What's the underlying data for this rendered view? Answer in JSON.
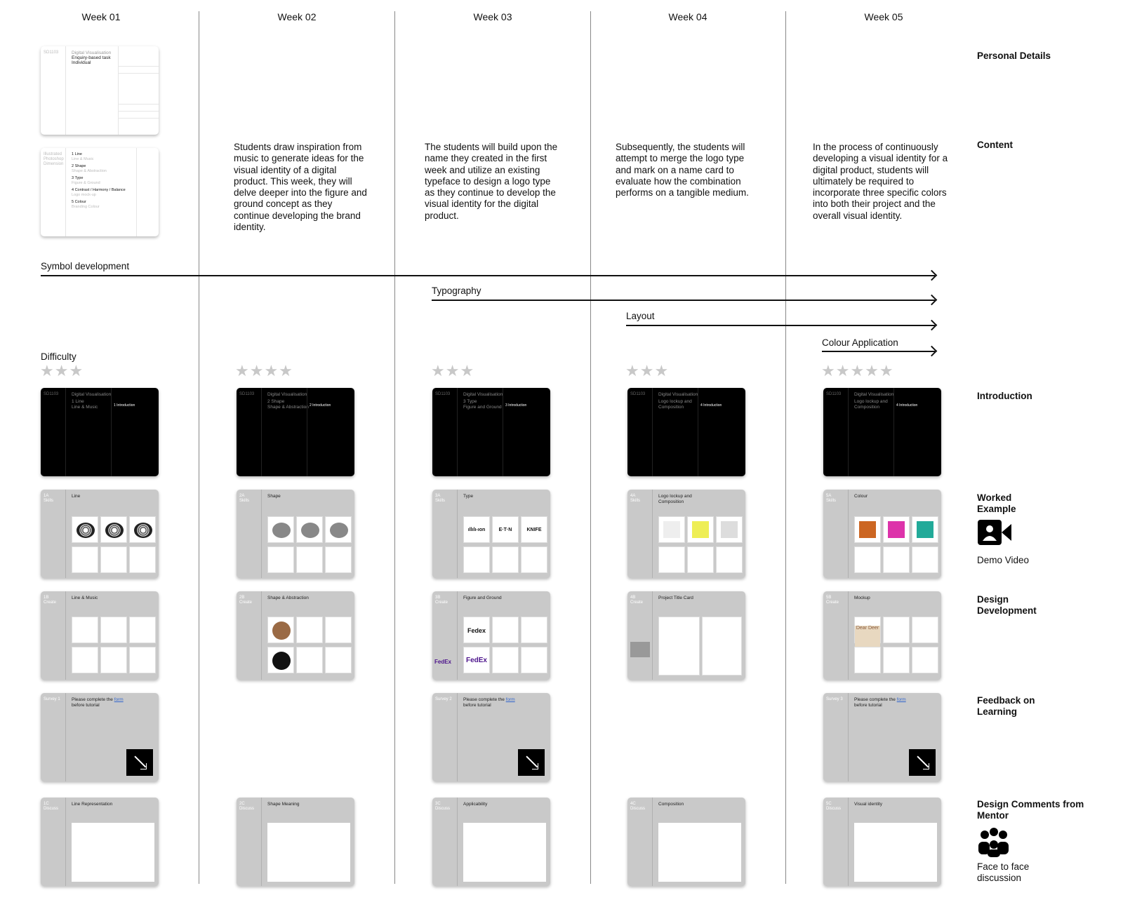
{
  "weeks": [
    "Week 01",
    "Week 02",
    "Week 03",
    "Week 04",
    "Week 05"
  ],
  "row_labels": {
    "personal_details": "Personal Details",
    "content": "Content",
    "introduction": "Introduction",
    "worked_example": "Worked Example",
    "demo_video": "Demo Video",
    "design_development": "Design Development",
    "feedback": "Feedback on Learning",
    "mentor": "Design Comments from Mentor",
    "face_to_face": "Face to face discussion"
  },
  "content_paragraphs": {
    "week02": "Students draw inspiration from music to generate ideas for the visual identity of a digital product. This week, they will delve deeper into the figure and ground concept as they continue developing the brand identity.",
    "week03": "The students will build upon the name they created in the first week and utilize an existing typeface to design a logo type as they continue to develop the visual identity for the digital product.",
    "week04": "Subsequently, the students will attempt to merge the logo type and mark on a name card to evaluate how the combination performs on a tangible medium.",
    "week05": "In the process of continuously developing a visual identity for a digital product, students will ultimately be required to incorporate three specific colors into both their project and the overall visual identity."
  },
  "tracks": {
    "symbol": "Symbol development",
    "typography": "Typography",
    "layout": "Layout",
    "colour": "Colour Application"
  },
  "difficulty": {
    "label": "Difficulty",
    "ratings": [
      3,
      4,
      3,
      3,
      5
    ],
    "star_glyphs": [
      "★★★",
      "★★★★",
      "★★★",
      "★★★",
      "★★★★★"
    ]
  },
  "personal_card": {
    "code": "SD1103",
    "line1": "Digital Visualisation",
    "line2": "Enquiry-based task",
    "line3": "Individual"
  },
  "content_card": {
    "side": "Illustrated Photoshop Dimension",
    "items": [
      {
        "title": "1 Line",
        "sub": "Line & Music"
      },
      {
        "title": "2 Shape",
        "sub": "Shape & Abstraction"
      },
      {
        "title": "3 Type",
        "sub": "Figure & Ground"
      },
      {
        "title": "4 Contrast / Harmony / Balance",
        "sub": "Logo mock-up"
      },
      {
        "title": "5 Colour",
        "sub": "Branding Colour"
      }
    ]
  },
  "intro_cards": [
    {
      "code": "SD1103",
      "course": "Digital Visualisation",
      "topic": "1 Line\nLine & Music",
      "intro": "1 Introduction"
    },
    {
      "code": "SD1103",
      "course": "Digital Visualisation",
      "topic": "2 Shape\nShape & Abstraction",
      "intro": "2 Introduction"
    },
    {
      "code": "SD1103",
      "course": "Digital Visualisation",
      "topic": "3 Type\nFigure and Ground",
      "intro": "3 Introduction"
    },
    {
      "code": "SD1103",
      "course": "Digital Visualisation",
      "topic": "Logo lockup and\nComposition",
      "intro": "4 Introduction"
    },
    {
      "code": "SD1103",
      "course": "Digital Visualisation",
      "topic": "Logo lockup and\nComposition",
      "intro": "4 Introduction"
    }
  ],
  "worked_cards": [
    {
      "side": "1A\nSkills",
      "title": "Line"
    },
    {
      "side": "2A\nSkills",
      "title": "Shape"
    },
    {
      "side": "3A\nSkills",
      "title": "Type"
    },
    {
      "side": "4A\nSkills",
      "title": "Logo lockup and\nComposition"
    },
    {
      "side": "5A\nSkills",
      "title": "Colour"
    }
  ],
  "worked_logos": [
    "ıllılı-ıon",
    "E·T·N",
    "KNIFE"
  ],
  "development_cards": [
    {
      "side": "1B\nCreate",
      "title": "Line & Music"
    },
    {
      "side": "2B\nCreate",
      "title": "Shape & Abstraction"
    },
    {
      "side": "3B\nCreate",
      "title": "Figure and Ground"
    },
    {
      "side": "4B\nCreate",
      "title": "Project Title Card"
    },
    {
      "side": "5B\nCreate",
      "title": "Mockup"
    }
  ],
  "development_logos": {
    "fedex1": "Fedex",
    "fedex2": "FedEx",
    "fedex3": "FedEx",
    "dear_deer": "Dear Deer"
  },
  "survey_cards": [
    {
      "side": "Survey 1",
      "text": "Please complete the ",
      "link": "form",
      "text2": "before tutorial"
    },
    {
      "side": "Survey 2",
      "text": "Please complete the ",
      "link": "form",
      "text2": "before tutorial"
    },
    {
      "side": "Survey 3",
      "text": "Please complete the ",
      "link": "form",
      "text2": "before tutorial"
    }
  ],
  "mentor_cards": [
    {
      "side": "1C\nDiscuss",
      "title": "Line Representation"
    },
    {
      "side": "2C\nDiscuss",
      "title": "Shape Meaning"
    },
    {
      "side": "3C\nDiscuss",
      "title": "Applicability"
    },
    {
      "side": "4C\nDiscuss",
      "title": "Composition"
    },
    {
      "side": "5C\nDiscuss",
      "title": "Visual identity"
    }
  ],
  "icons": {
    "video": "video-camera-icon",
    "people": "people-discussion-icon"
  }
}
